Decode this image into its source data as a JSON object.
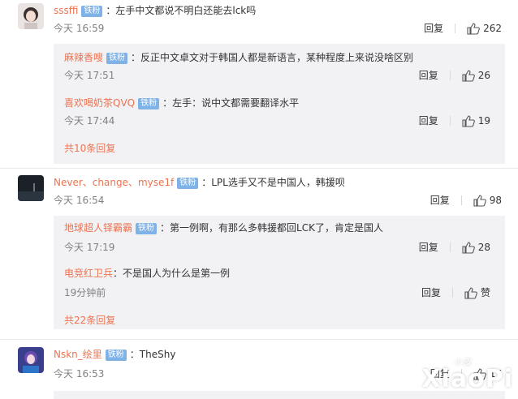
{
  "comments": [
    {
      "user": "sssffi",
      "badge": "铁粉",
      "text": "：左手中文都说不明白还能去lck吗",
      "time": "今天 16:59",
      "reply_label": "回复",
      "likes": "262",
      "replies": [
        {
          "user": "麻辣香嗖",
          "badge": "铁粉",
          "text": "：反正中文卓文对于韩国人都是新语言，某种程度上来说没啥区别",
          "time": "今天 17:51",
          "reply_label": "回复",
          "likes": "26"
        },
        {
          "user": "喜欢喝奶茶QVQ",
          "badge": "铁粉",
          "text": "：左手：说中文都需要翻译水平",
          "time": "今天 17:44",
          "reply_label": "回复",
          "likes": "19"
        }
      ],
      "more_replies": "共10条回复"
    },
    {
      "user": "Never、change、myse1f",
      "badge": "铁粉",
      "text": "：LPL选手又不是中国人，韩援呗",
      "time": "今天 16:54",
      "reply_label": "回复",
      "likes": "98",
      "replies": [
        {
          "user": "地球超人铎霸霸",
          "badge": "铁粉",
          "text": "：第一例啊，有那么多韩援都回LCK了，肯定是国人",
          "time": "今天 17:19",
          "reply_label": "回复",
          "likes": "28"
        },
        {
          "user": "电竞红卫兵",
          "badge": "",
          "text": "：不是国人为什么是第一例",
          "time": "19分钟前",
          "reply_label": "回复",
          "likes": "赞"
        }
      ],
      "more_replies": "共22条回复"
    },
    {
      "user": "Nskn_绘里",
      "badge": "铁粉",
      "text": "：TheShy",
      "time": "今天 16:53",
      "reply_label": "回复",
      "likes": "17"
    }
  ],
  "watermark": {
    "main": "XiaoPi",
    "sub": "小皮"
  },
  "icons": {
    "like": "thumbs-up-icon"
  },
  "colors": {
    "username": "#eb7350",
    "badge": "#7fb2e6",
    "reply_box": "#f2f2f5"
  }
}
